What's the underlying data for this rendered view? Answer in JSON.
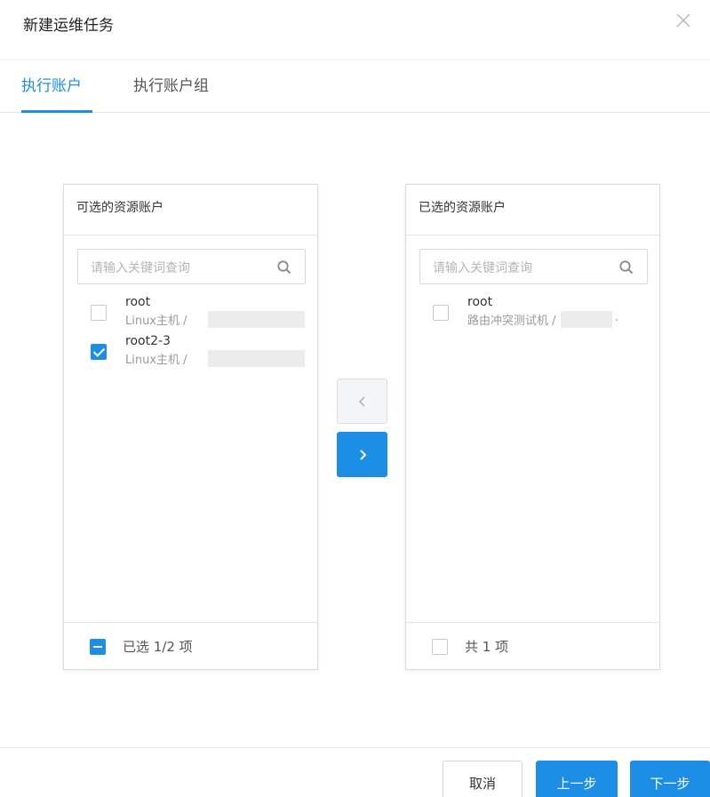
{
  "dialog": {
    "title": "新建运维任务",
    "close_icon": "close-icon"
  },
  "tabs": [
    {
      "label": "执行账户",
      "active": true
    },
    {
      "label": "执行账户组",
      "active": false
    }
  ],
  "source_panel": {
    "title": "可选的资源账户",
    "search_placeholder": "请输入关键词查询",
    "items": [
      {
        "name": "root",
        "sub": "Linux主机 /",
        "checked": false
      },
      {
        "name": "root2-3",
        "sub": "Linux主机 /",
        "checked": true
      }
    ],
    "footer": "已选 1/2 项",
    "footer_state": "indeterminate"
  },
  "target_panel": {
    "title": "已选的资源账户",
    "search_placeholder": "请输入关键词查询",
    "items": [
      {
        "name": "root",
        "sub": "路由冲突测试机 /",
        "trail": ".",
        "checked": false
      }
    ],
    "footer": "共 1 项",
    "footer_state": "unchecked"
  },
  "transfer": {
    "move_left_icon": "chevron-left-icon",
    "move_right_icon": "chevron-right-icon"
  },
  "footer_buttons": {
    "cancel": "取消",
    "prev": "上一步",
    "next": "下一步"
  },
  "colors": {
    "accent": "#1c8ee6",
    "disabled_bg": "#f4f5f7"
  }
}
